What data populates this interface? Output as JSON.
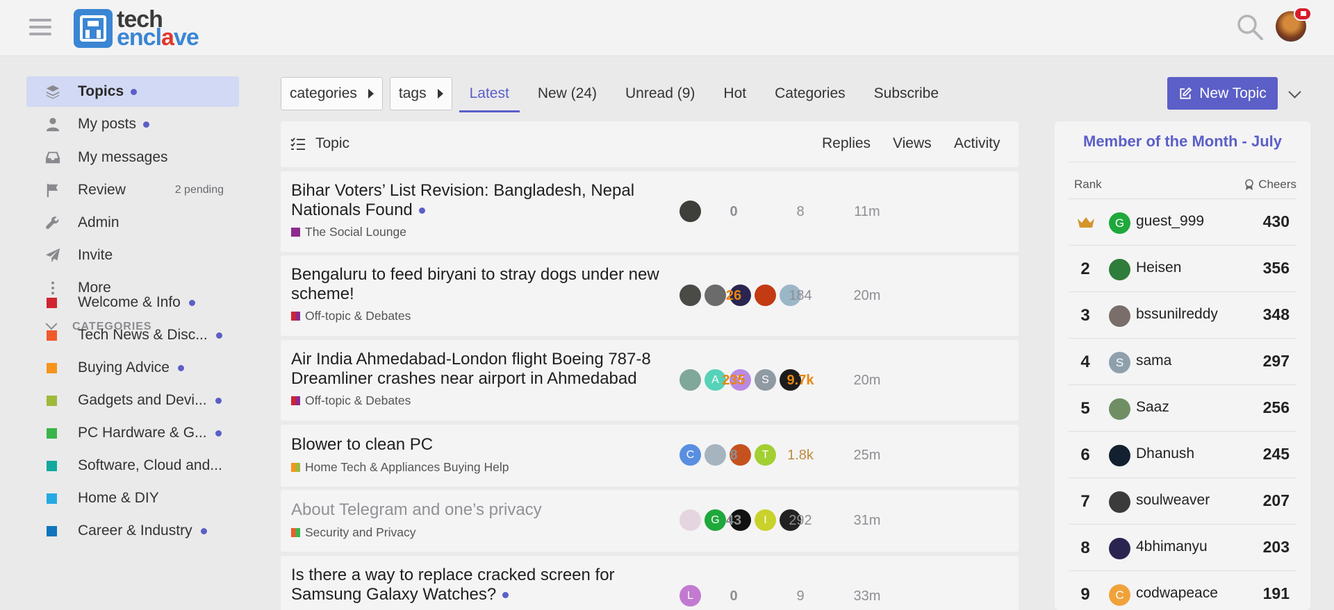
{
  "header": {
    "logo_top": "tech",
    "logo_bottom_1": "encl",
    "logo_bottom_v": "a",
    "logo_bottom_2": "ve"
  },
  "sidebar": {
    "items": [
      {
        "label": "Topics",
        "icon": "layers-icon",
        "dot": true,
        "active": true
      },
      {
        "label": "My posts",
        "icon": "user-icon",
        "dot": true
      },
      {
        "label": "My messages",
        "icon": "inbox-icon"
      },
      {
        "label": "Review",
        "icon": "flag-icon",
        "pending": "2 pending"
      },
      {
        "label": "Admin",
        "icon": "wrench-icon"
      },
      {
        "label": "Invite",
        "icon": "paper-plane-icon"
      },
      {
        "label": "More",
        "icon": "ellipsis-vertical-icon"
      }
    ],
    "categories_label": "CATEGORIES",
    "categories": [
      {
        "label": "Welcome & Info",
        "color": "#d02530",
        "dot": true
      },
      {
        "label": "Tech News & Disc...",
        "color": "#f05b2b",
        "dot": true
      },
      {
        "label": "Buying Advice",
        "color": "#f7941d",
        "dot": true
      },
      {
        "label": "Gadgets and Devi...",
        "color": "#9fb93b",
        "dot": true
      },
      {
        "label": "PC Hardware & G...",
        "color": "#3ab54a",
        "dot": true
      },
      {
        "label": "Software, Cloud and...",
        "color": "#12a89d",
        "dot": false
      },
      {
        "label": "Home & DIY",
        "color": "#25aae1",
        "dot": false
      },
      {
        "label": "Career & Industry",
        "color": "#0e76bd",
        "dot": true
      }
    ]
  },
  "nav": {
    "categories_drop": "categories",
    "tags_drop": "tags",
    "tabs": [
      "Latest",
      "New (24)",
      "Unread (9)",
      "Hot",
      "Categories",
      "Subscribe"
    ],
    "active_tab": "Latest",
    "new_topic": "New Topic"
  },
  "topic_list": {
    "headers": {
      "topic": "Topic",
      "replies": "Replies",
      "views": "Views",
      "activity": "Activity"
    },
    "rows": [
      {
        "title_line1": "Bihar Voters’ List Revision: Bangladesh, Nepal",
        "title_line2": "Nationals Found",
        "unread_dot": true,
        "category": "The Social Lounge",
        "cat_colors": [
          "#8e2a8f",
          "#8e2a8f"
        ],
        "replies": "0",
        "views": "8",
        "activity": "11m",
        "posters": [
          {
            "letter": "",
            "color": "#3e3f3a"
          }
        ]
      },
      {
        "title_line1": "Bengaluru to feed biryani to stray dogs under new",
        "title_line2": "scheme!",
        "unread_dot": false,
        "category": "Off-topic & Debates",
        "cat_colors": [
          "#d02530",
          "#8e2a8f"
        ],
        "replies": "26",
        "views": "184",
        "activity": "20m",
        "posters": [
          {
            "letter": "",
            "color": "#4a4a46"
          },
          {
            "letter": "",
            "color": "#6b6b6b"
          },
          {
            "letter": "",
            "color": "#2a2550"
          },
          {
            "letter": "",
            "color": "#c23b12"
          },
          {
            "letter": "",
            "color": "#9bb7c7"
          }
        ]
      },
      {
        "title_line1": "Air India Ahmedabad-London flight Boeing 787-8",
        "title_line2": "Dreamliner crashes near airport in Ahmedabad",
        "unread_dot": false,
        "category": "Off-topic & Debates",
        "cat_colors": [
          "#d02530",
          "#8e2a8f"
        ],
        "replies": "235",
        "views": "9.7k",
        "activity": "20m",
        "posters": [
          {
            "letter": "",
            "color": "#7fa79a"
          },
          {
            "letter": "A",
            "color": "#57d2b8"
          },
          {
            "letter": "Y",
            "color": "#b98ae4"
          },
          {
            "letter": "S",
            "color": "#8f9aa3"
          },
          {
            "letter": "",
            "color": "#1d1d1d"
          }
        ]
      },
      {
        "title_line1": "Blower to clean PC",
        "title_line2": "",
        "unread_dot": false,
        "category": "Home Tech & Appliances Buying Help",
        "cat_colors": [
          "#f7941d",
          "#9fb93b"
        ],
        "replies": "8",
        "views": "1.8k",
        "activity": "25m",
        "posters": [
          {
            "letter": "C",
            "color": "#5a8ee0"
          },
          {
            "letter": "",
            "color": "#a6b4c0"
          },
          {
            "letter": "",
            "color": "#c5521e"
          },
          {
            "letter": "T",
            "color": "#a2cf32"
          }
        ]
      },
      {
        "title_line1": "About Telegram and one’s privacy",
        "title_line2": "",
        "unread_dot": false,
        "visited": true,
        "category": "Security and Privacy",
        "cat_colors": [
          "#f05b2b",
          "#3ab54a"
        ],
        "replies": "43",
        "views": "292",
        "activity": "31m",
        "posters": [
          {
            "letter": "",
            "color": "#e5d5e0"
          },
          {
            "letter": "G",
            "color": "#1fa83b"
          },
          {
            "letter": "",
            "color": "#111111"
          },
          {
            "letter": "I",
            "color": "#c9d22a"
          },
          {
            "letter": "",
            "color": "#222222"
          }
        ]
      },
      {
        "title_line1": "Is there a way to replace cracked screen for",
        "title_line2": "Samsung Galaxy Watches?",
        "unread_dot": true,
        "category": "",
        "cat_colors": [],
        "replies": "0",
        "views": "9",
        "activity": "33m",
        "posters": [
          {
            "letter": "L",
            "color": "#c27ad1"
          }
        ]
      }
    ]
  },
  "member_of_month": {
    "title": "Member of the Month - July",
    "rank_header": "Rank",
    "cheers_header": "Cheers",
    "members": [
      {
        "rank": "",
        "crown": true,
        "name": "guest_999",
        "score": "430",
        "letter": "G",
        "color": "#1fa83b"
      },
      {
        "rank": "2",
        "name": "Heisen",
        "score": "356",
        "letter": "",
        "color": "#2f7d3a"
      },
      {
        "rank": "3",
        "name": "bssunilreddy",
        "score": "348",
        "letter": "",
        "color": "#7a6e6a"
      },
      {
        "rank": "4",
        "name": "sama",
        "score": "297",
        "letter": "S",
        "color": "#8fa0ad"
      },
      {
        "rank": "5",
        "name": "Saaz",
        "score": "256",
        "letter": "",
        "color": "#6f8e64"
      },
      {
        "rank": "6",
        "name": "Dhanush",
        "score": "245",
        "letter": "",
        "color": "#12202f"
      },
      {
        "rank": "7",
        "name": "soulweaver",
        "score": "207",
        "letter": "",
        "color": "#3b3b3b"
      },
      {
        "rank": "8",
        "name": "4bhimanyu",
        "score": "203",
        "letter": "",
        "color": "#2a2550"
      },
      {
        "rank": "9",
        "name": "codwapeace",
        "score": "191",
        "letter": "C",
        "color": "#f0a23a"
      }
    ]
  }
}
